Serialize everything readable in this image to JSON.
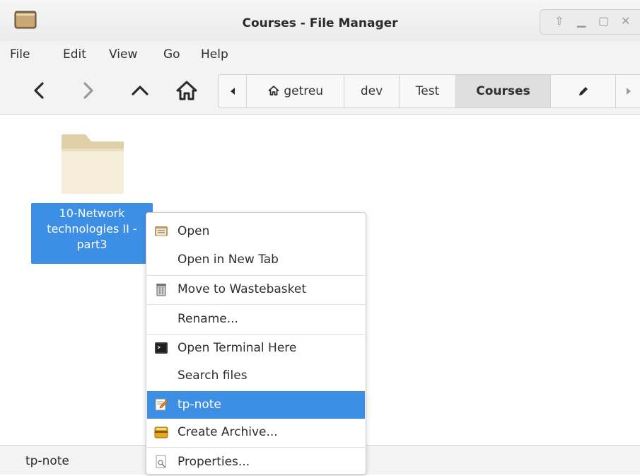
{
  "window": {
    "title": "Courses - File Manager",
    "controls": [
      "up-icon",
      "minimize-icon",
      "maximize-icon",
      "close-icon"
    ]
  },
  "menubar": {
    "items": [
      "File",
      "Edit",
      "View",
      "Go",
      "Help"
    ]
  },
  "toolbar": {
    "buttons": [
      "back-icon",
      "forward-icon",
      "up-arrow-icon",
      "home-icon"
    ],
    "pathbar": {
      "segments": [
        "getreu",
        "dev",
        "Test",
        "Courses"
      ],
      "active": "Courses",
      "home_segment_icon": "home-icon"
    }
  },
  "content": {
    "items": [
      {
        "type": "folder",
        "name_lines": [
          "10-Network",
          "technologies II -",
          "part3"
        ],
        "selected": true
      }
    ]
  },
  "context_menu": {
    "items": [
      {
        "label": "Open",
        "icon": "folder-open-icon"
      },
      {
        "label": "Open in New Tab",
        "icon": ""
      },
      {
        "label": "Move to Wastebasket",
        "icon": "trash-icon"
      },
      {
        "label": "Rename...",
        "icon": ""
      },
      {
        "label": "Open Terminal Here",
        "icon": "terminal-icon"
      },
      {
        "label": "Search files",
        "icon": ""
      },
      {
        "label": "tp-note",
        "icon": "edit-note-icon",
        "highlighted": true
      },
      {
        "label": "Create Archive...",
        "icon": "archive-icon"
      },
      {
        "label": "Properties...",
        "icon": "properties-icon"
      }
    ]
  },
  "statusbar": {
    "text": "tp-note"
  },
  "colors": {
    "selection": "#3d8ee5",
    "folder": "#efe3c7",
    "chrome": "#f3f3f3"
  }
}
